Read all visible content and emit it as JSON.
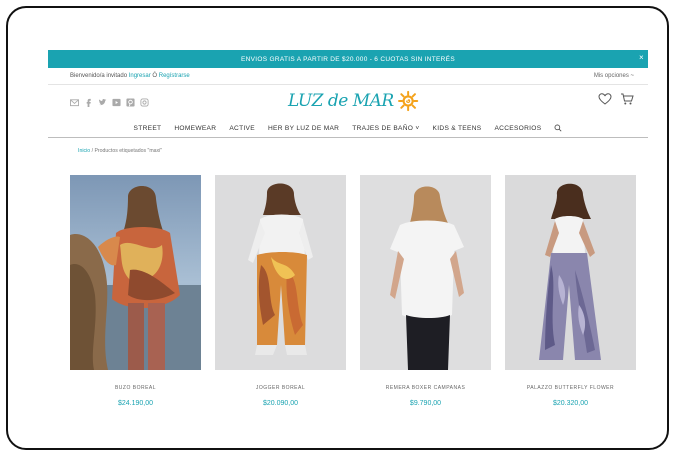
{
  "promo": {
    "text": "ENVIOS GRATIS A PARTIR DE $20.000 - 6 CUOTAS SIN INTERÉS",
    "close": "×"
  },
  "userbar": {
    "welcome_prefix": "Bienvenido/a invitado",
    "login": "Ingresar",
    "separator": " Ó ",
    "register": "Regístrarse",
    "options": "Mis opciones ~"
  },
  "logo": {
    "text": "LUZ de MAR"
  },
  "colors": {
    "accent": "#1aa3b1",
    "sun": "#f4a21b"
  },
  "social_icons": [
    "mail-icon",
    "facebook-icon",
    "twitter-icon",
    "youtube-icon",
    "pinterest-icon",
    "instagram-icon"
  ],
  "nav": {
    "items": [
      "STREET",
      "HOMEWEAR",
      "ACTIVE",
      "HER BY LUZ DE MAR",
      "TRAJES DE BAÑO",
      "KIDS & TEENS",
      "ACCESORIOS"
    ]
  },
  "breadcrumb": {
    "home": "Inicio",
    "current": " / Productos etiquetados \"maxi\""
  },
  "products": [
    {
      "name": "BUZO BOREAL",
      "price": "$24.190,00"
    },
    {
      "name": "JOGGER BOREAL",
      "price": "$20.090,00"
    },
    {
      "name": "REMERA BOXER CAMPANAS",
      "price": "$9.790,00"
    },
    {
      "name": "PALAZZO BUTTERFLY FLOWER",
      "price": "$20.320,00"
    }
  ]
}
